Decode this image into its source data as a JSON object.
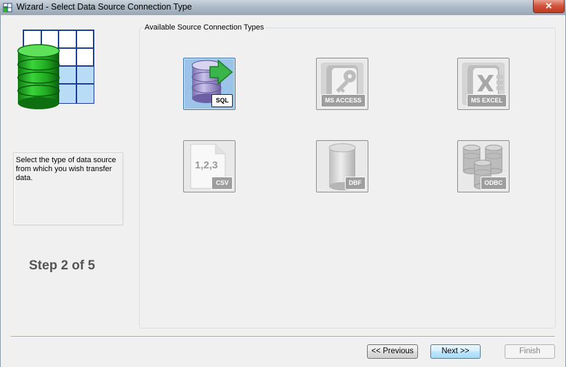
{
  "window": {
    "title": "Wizard - Select Data Source Connection Type",
    "close_glyph": "✕"
  },
  "sidebar": {
    "description": "Select the type of data source from which you wish transfer data.",
    "step": "Step 2 of 5"
  },
  "group": {
    "label": "Available Source Connection Types",
    "tiles": [
      {
        "label": "SQL",
        "icon": "sql-database-icon",
        "selected": true
      },
      {
        "label": "MS ACCESS",
        "icon": "ms-access-icon",
        "selected": false
      },
      {
        "label": "MS EXCEL",
        "icon": "ms-excel-icon",
        "selected": false
      },
      {
        "label": "CSV",
        "icon": "csv-file-icon",
        "selected": false
      },
      {
        "label": "DBF",
        "icon": "dbf-file-icon",
        "selected": false
      },
      {
        "label": "ODBC",
        "icon": "odbc-icon",
        "selected": false
      }
    ],
    "csv_glyph": "1,2,3"
  },
  "buttons": {
    "previous": "<< Previous",
    "next": "Next >>",
    "finish": "Finish",
    "finish_enabled": false
  },
  "colors": {
    "selected_tile": "#9cc3e8",
    "database_green": "#2fb52a",
    "grid_blue": "#1a3a9c"
  }
}
